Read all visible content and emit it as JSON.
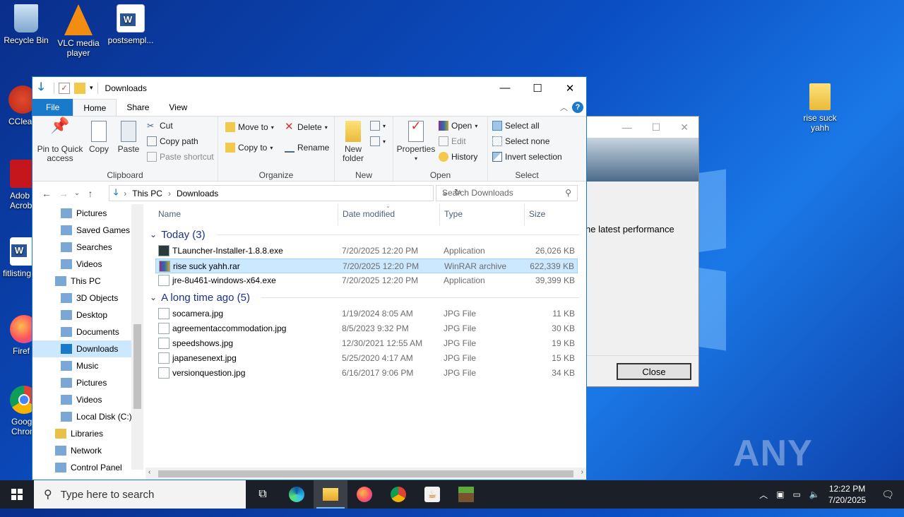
{
  "desktop": {
    "icons": [
      {
        "label": "Recycle Bin",
        "icon": "recycle-bin-icon"
      },
      {
        "label": "VLC media player",
        "icon": "vlc-icon"
      },
      {
        "label": "postsempl...",
        "icon": "word-doc-icon"
      },
      {
        "label": "CClea",
        "icon": "ccleaner-icon"
      },
      {
        "label": "Adob Acrob",
        "icon": "acrobat-icon"
      },
      {
        "label": "fitlisting",
        "icon": "word-doc-icon"
      },
      {
        "label": "Firef",
        "icon": "firefox-icon"
      },
      {
        "label": "Goog Chron",
        "icon": "chrome-icon"
      },
      {
        "label": "rise suck yahh",
        "icon": "folder-icon"
      }
    ],
    "watermark": "ANY RUN"
  },
  "dialog": {
    "text": "he latest performance",
    "close_label": "Close"
  },
  "window": {
    "title": "Downloads",
    "tabs": [
      "File",
      "Home",
      "Share",
      "View"
    ],
    "ribbon": {
      "clipboard": {
        "pin": "Pin to Quick access",
        "copy": "Copy",
        "paste": "Paste",
        "cut": "Cut",
        "copy_path": "Copy path",
        "paste_shortcut": "Paste shortcut",
        "group": "Clipboard"
      },
      "organize": {
        "move_to": "Move to",
        "copy_to": "Copy to",
        "delete": "Delete",
        "rename": "Rename",
        "group": "Organize"
      },
      "new": {
        "new_folder": "New folder",
        "group": "New"
      },
      "open": {
        "properties": "Properties",
        "open": "Open",
        "edit": "Edit",
        "history": "History",
        "group": "Open"
      },
      "select": {
        "select_all": "Select all",
        "select_none": "Select none",
        "invert": "Invert selection",
        "group": "Select"
      }
    },
    "breadcrumb": [
      "This PC",
      "Downloads"
    ],
    "search_placeholder": "Search Downloads",
    "nav": [
      {
        "label": "Pictures",
        "indent": 1,
        "icon": "pictures-icon"
      },
      {
        "label": "Saved Games",
        "indent": 1,
        "icon": "saved-games-icon"
      },
      {
        "label": "Searches",
        "indent": 1,
        "icon": "searches-icon"
      },
      {
        "label": "Videos",
        "indent": 1,
        "icon": "videos-icon"
      },
      {
        "label": "This PC",
        "indent": 0,
        "icon": "this-pc-icon"
      },
      {
        "label": "3D Objects",
        "indent": 1,
        "icon": "3d-objects-icon"
      },
      {
        "label": "Desktop",
        "indent": 1,
        "icon": "desktop-icon"
      },
      {
        "label": "Documents",
        "indent": 1,
        "icon": "documents-icon"
      },
      {
        "label": "Downloads",
        "indent": 1,
        "icon": "downloads-icon",
        "selected": true
      },
      {
        "label": "Music",
        "indent": 1,
        "icon": "music-icon"
      },
      {
        "label": "Pictures",
        "indent": 1,
        "icon": "pictures-icon"
      },
      {
        "label": "Videos",
        "indent": 1,
        "icon": "videos-icon"
      },
      {
        "label": "Local Disk (C:)",
        "indent": 1,
        "icon": "local-disk-icon"
      },
      {
        "label": "Libraries",
        "indent": 0,
        "icon": "libraries-icon"
      },
      {
        "label": "Network",
        "indent": 0,
        "icon": "network-icon"
      },
      {
        "label": "Control Panel",
        "indent": 0,
        "icon": "control-panel-icon"
      }
    ],
    "columns": [
      "Name",
      "Date modified",
      "Type",
      "Size"
    ],
    "groups": [
      {
        "label": "Today (3)",
        "files": [
          {
            "name": "TLauncher-Installer-1.8.8.exe",
            "date": "7/20/2025 12:20 PM",
            "type": "Application",
            "size": "26,026 KB",
            "icon": "tlauncher-icon"
          },
          {
            "name": "rise suck yahh.rar",
            "date": "7/20/2025 12:20 PM",
            "type": "WinRAR archive",
            "size": "622,339 KB",
            "icon": "winrar-icon",
            "selected": true
          },
          {
            "name": "jre-8u461-windows-x64.exe",
            "date": "7/20/2025 12:20 PM",
            "type": "Application",
            "size": "39,399 KB",
            "icon": "java-icon"
          }
        ]
      },
      {
        "label": "A long time ago (5)",
        "files": [
          {
            "name": "socamera.jpg",
            "date": "1/19/2024 8:05 AM",
            "type": "JPG File",
            "size": "11 KB",
            "icon": "jpg-file-icon"
          },
          {
            "name": "agreementaccommodation.jpg",
            "date": "8/5/2023 9:32 PM",
            "type": "JPG File",
            "size": "30 KB",
            "icon": "jpg-file-icon"
          },
          {
            "name": "speedshows.jpg",
            "date": "12/30/2021 12:55 AM",
            "type": "JPG File",
            "size": "19 KB",
            "icon": "jpg-file-icon"
          },
          {
            "name": "japanesenext.jpg",
            "date": "5/25/2020 4:17 AM",
            "type": "JPG File",
            "size": "15 KB",
            "icon": "jpg-file-icon"
          },
          {
            "name": "versionquestion.jpg",
            "date": "6/16/2017 9:06 PM",
            "type": "JPG File",
            "size": "34 KB",
            "icon": "jpg-file-icon"
          }
        ]
      }
    ]
  },
  "taskbar": {
    "search_placeholder": "Type here to search",
    "time": "12:22 PM",
    "date": "7/20/2025",
    "apps": [
      "task-view-icon",
      "edge-icon",
      "file-explorer-icon",
      "firefox-icon",
      "chrome-icon",
      "java-icon",
      "minecraft-icon"
    ]
  },
  "colors": {
    "accent": "#1979ca",
    "selection": "#cce8ff",
    "group_header": "#1e3287",
    "taskbar": "#1b1f27"
  }
}
